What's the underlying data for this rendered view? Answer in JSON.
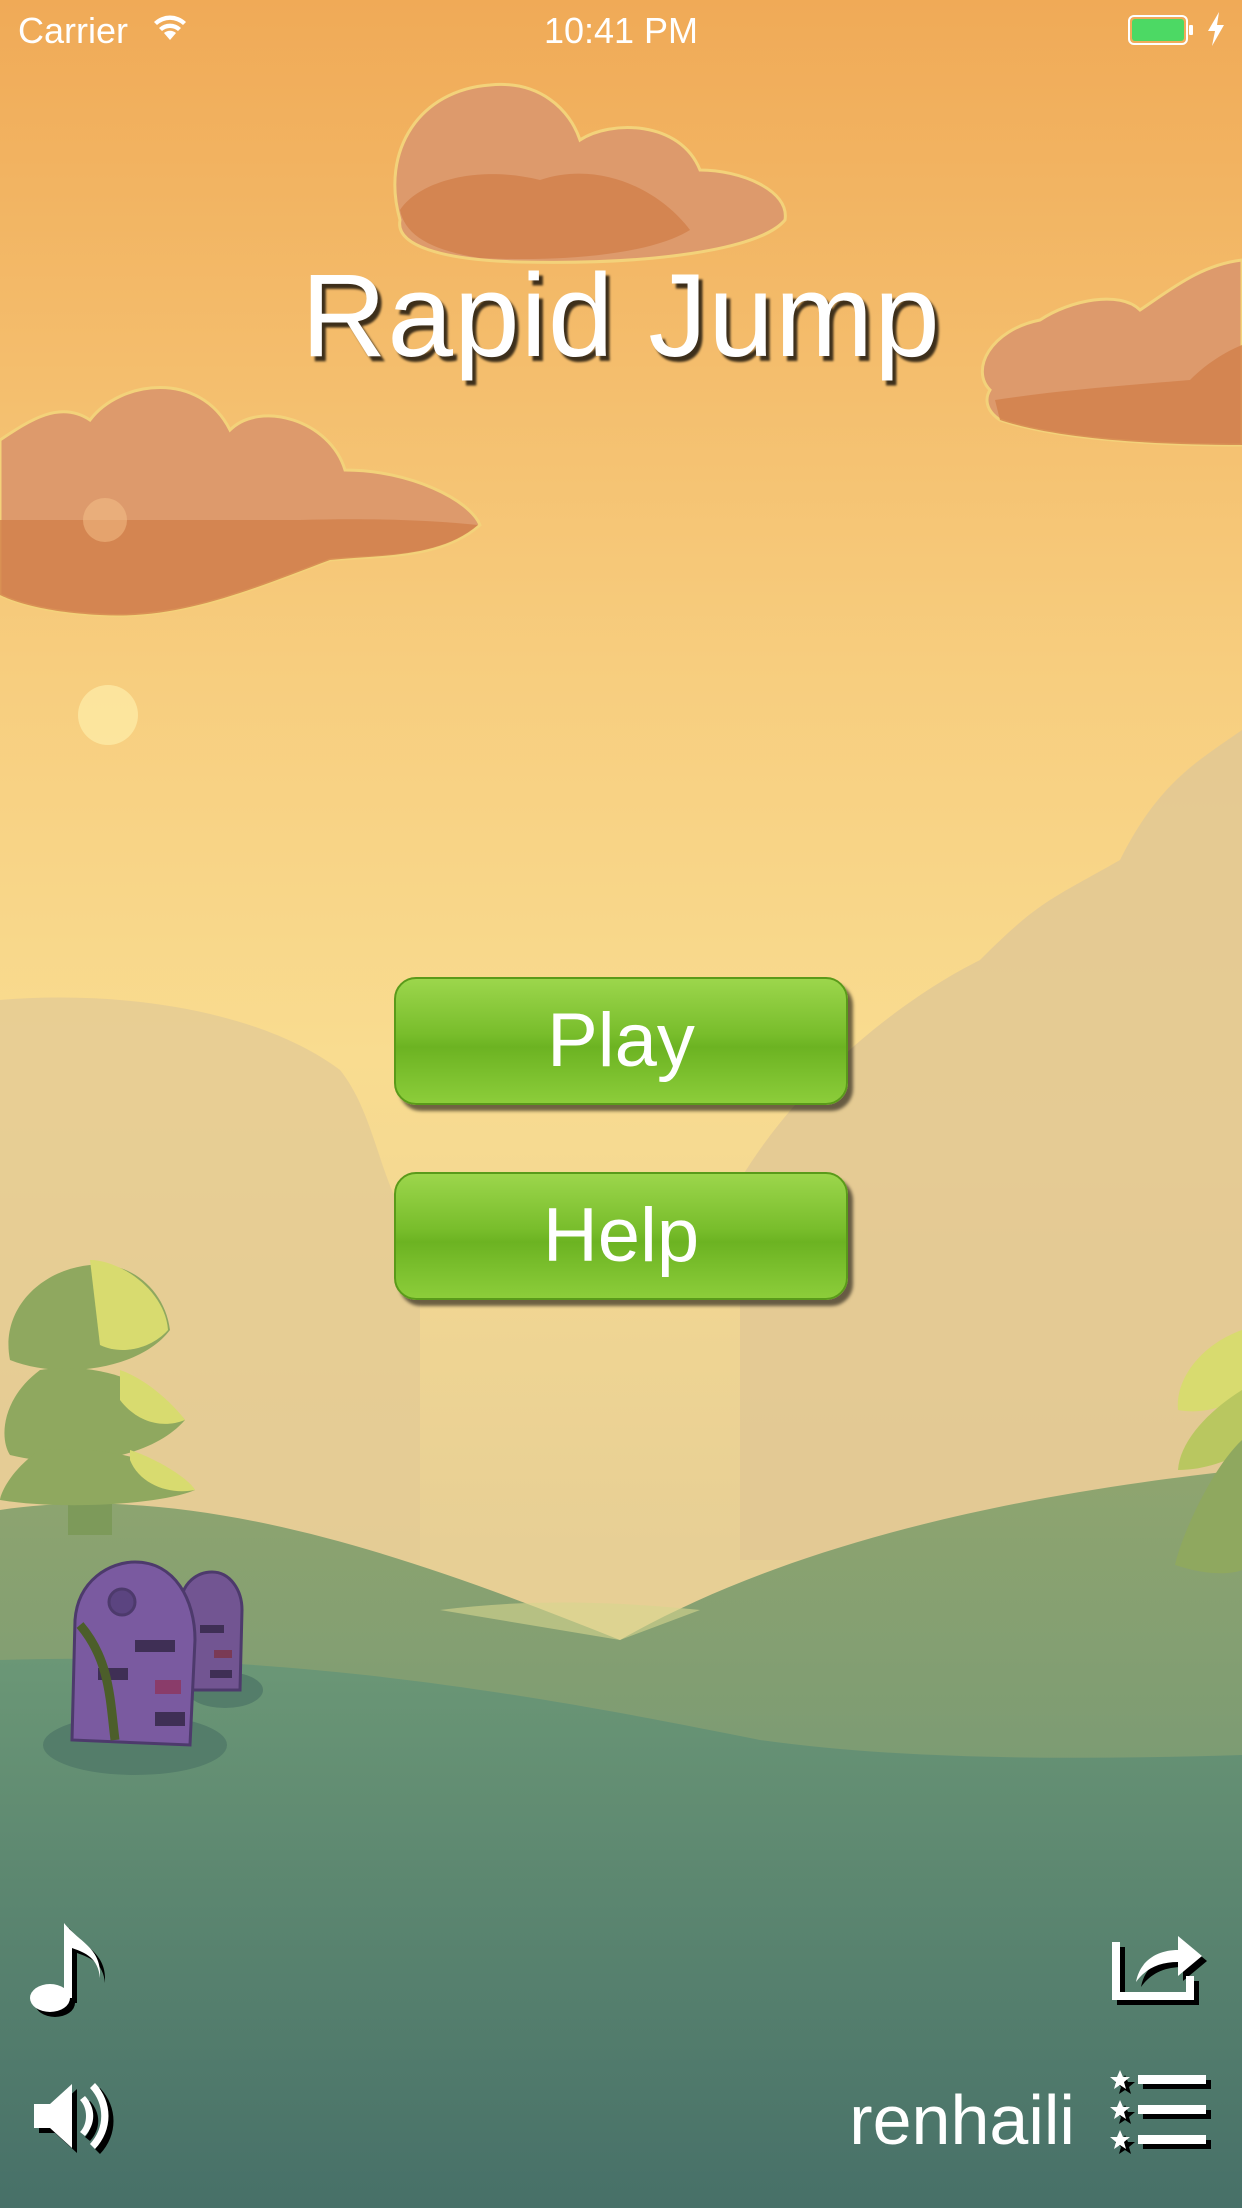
{
  "status_bar": {
    "carrier": "Carrier",
    "time": "10:41 PM",
    "battery_color": "#4cd964"
  },
  "game": {
    "title": "Rapid Jump",
    "play_label": "Play",
    "help_label": "Help",
    "username": "renhaili"
  },
  "icons": {
    "music": "music-note-icon",
    "sound": "speaker-icon",
    "share": "share-icon",
    "leaderboard": "leaderboard-icon"
  },
  "colors": {
    "sky_top": "#f0ab58",
    "sky_mid": "#f9dd90",
    "ground": "#477068",
    "button": "#78bd2b"
  }
}
